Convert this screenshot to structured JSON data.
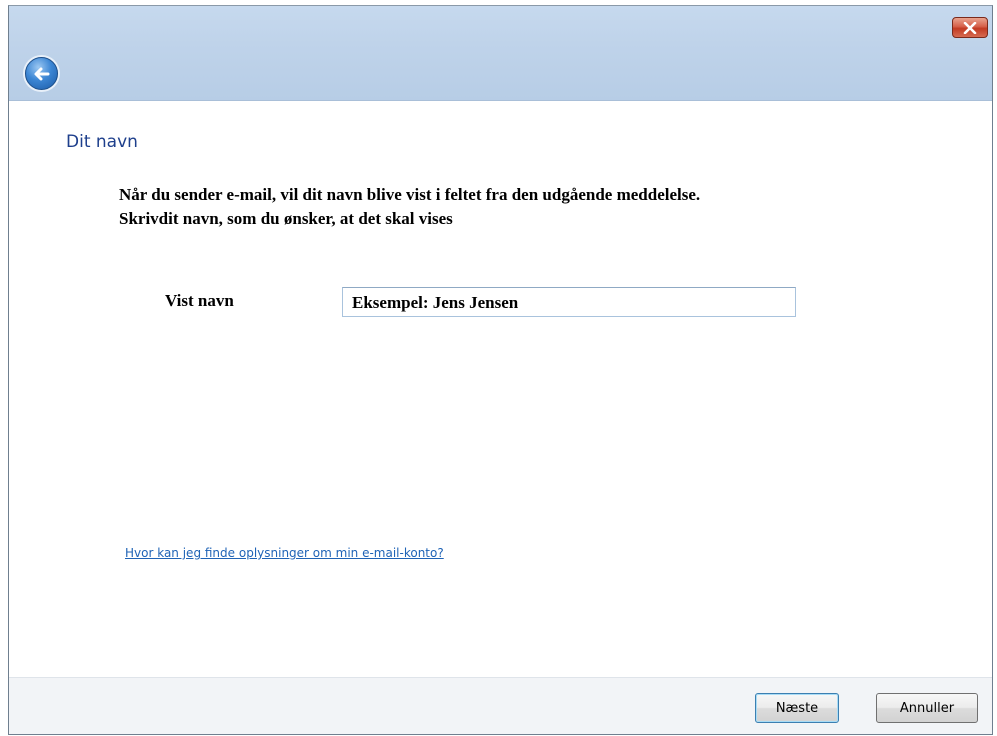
{
  "dialog": {
    "heading": "Dit navn",
    "instructions": [
      "Når du sender e-mail, vil dit navn blive vist i feltet fra den udgående meddelelse.",
      "Skrivdit navn, som du ønsker, at det skal vises"
    ],
    "field": {
      "label": "Vist navn",
      "value": "Eksempel: Jens Jensen"
    },
    "help_link": "Hvor kan jeg finde oplysninger om min e-mail-konto?"
  },
  "buttons": {
    "next": "Næste",
    "cancel": "Annuller"
  },
  "icons": {
    "close": "close-icon",
    "back": "back-arrow-icon"
  },
  "colors": {
    "titlebar": "#c3d7ed",
    "heading": "#1e3f8c",
    "link": "#1f63b6",
    "close_button": "#d6604a"
  }
}
